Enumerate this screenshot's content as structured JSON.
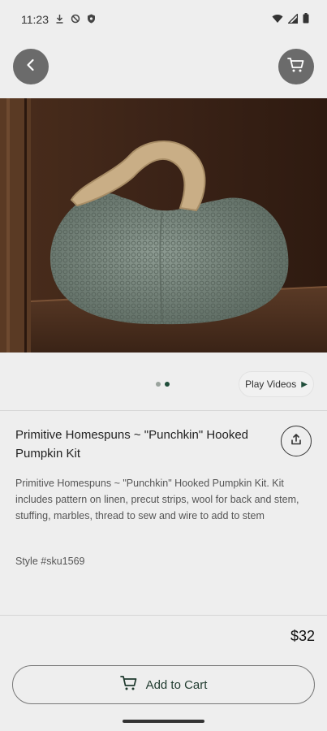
{
  "status_bar": {
    "time": "11:23",
    "left_icons": [
      "download-icon",
      "do-not-disturb-icon",
      "shield-icon"
    ],
    "right_icons": [
      "wifi-icon",
      "signal-icon",
      "battery-icon"
    ]
  },
  "top_bar": {
    "back_icon": "chevron-left-icon",
    "cart_icon": "cart-icon"
  },
  "hero": {
    "image": "hooked-pumpkin-photo",
    "pager_count": 2,
    "pager_active": 2
  },
  "media": {
    "play_videos_label": "Play Videos"
  },
  "product": {
    "title": "Primitive Homespuns ~ \"Punchkin\" Hooked Pumpkin Kit",
    "description": "Primitive Homespuns ~ \"Punchkin\" Hooked Pumpkin Kit. Kit includes pattern on linen, precut strips, wool for back and stem, stuffing, marbles, thread to sew and wire to add to stem",
    "style_sku": "Style #sku1569",
    "price": "$32"
  },
  "actions": {
    "add_to_cart_label": "Add to Cart",
    "share_icon": "share-icon"
  },
  "colors": {
    "accent": "#1f4d3a",
    "background": "#eeeeee",
    "circle_button": "#6b6b6b"
  }
}
